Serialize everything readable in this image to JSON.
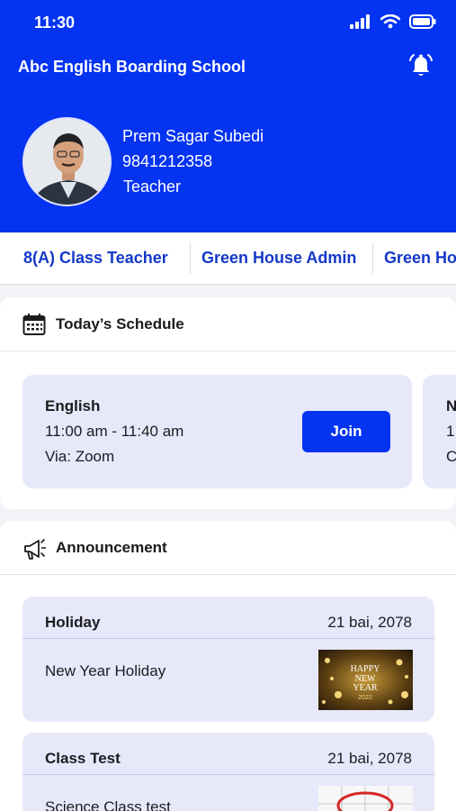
{
  "status_bar": {
    "time": "11:30"
  },
  "header": {
    "app_title": "Abc English Boarding School"
  },
  "profile": {
    "name": "Prem Sagar Subedi",
    "phone": "9841212358",
    "role": "Teacher"
  },
  "roles": [
    "8(A) Class Teacher",
    "Green House Admin",
    "Green Ho"
  ],
  "schedule": {
    "title": "Today’s Schedule",
    "items": [
      {
        "subject": "English",
        "time": "11:00 am - 11:40 am",
        "via": "Via: Zoom",
        "action": "Join"
      }
    ],
    "peek": {
      "line1": "N",
      "line2": "1",
      "line3": "C"
    }
  },
  "announcements": {
    "title": "Announcement",
    "items": [
      {
        "type": "Holiday",
        "date": "21 bai, 2078",
        "text": "New Year Holiday",
        "image_text": {
          "line1": "HAPPY",
          "line2": "NEW",
          "line3": "YEAR",
          "line4": "2022"
        }
      },
      {
        "type": "Class Test",
        "date": "21 bai, 2078",
        "text": "Science Class test"
      }
    ]
  },
  "colors": {
    "primary": "#0433f2",
    "card_bg": "#e7e9fb",
    "role_text": "#1538c8"
  },
  "icons": {
    "notification": "bell-icon",
    "schedule": "calendar-icon",
    "announcement": "megaphone-icon"
  }
}
